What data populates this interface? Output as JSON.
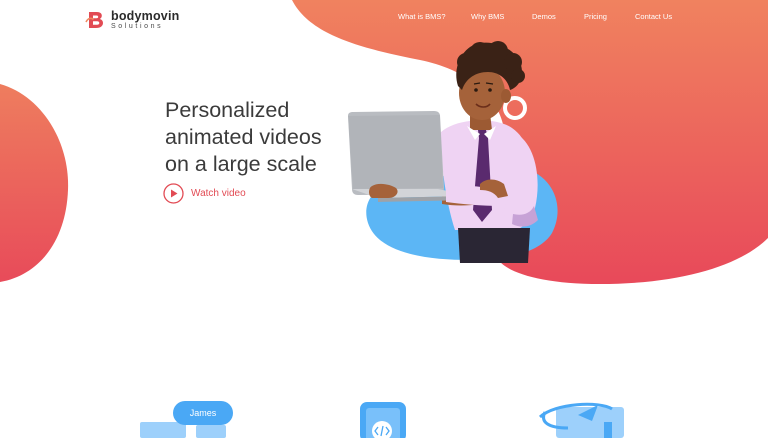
{
  "brand": {
    "name": "bodymovin",
    "subtitle": "Solutions"
  },
  "nav": {
    "items": [
      {
        "label": "What is BMS?"
      },
      {
        "label": "Why BMS"
      },
      {
        "label": "Demos"
      },
      {
        "label": "Pricing"
      },
      {
        "label": "Contact Us"
      }
    ]
  },
  "hero": {
    "headline_lines": [
      "Personalized",
      "animated videos",
      "on a large scale"
    ],
    "watch_label": "Watch video"
  },
  "features": {
    "chat_name": "James"
  },
  "colors": {
    "gradient_top": "#f0825f",
    "gradient_bottom": "#e8495a",
    "accent": "#e24b54",
    "blue": "#4aa8f5"
  }
}
